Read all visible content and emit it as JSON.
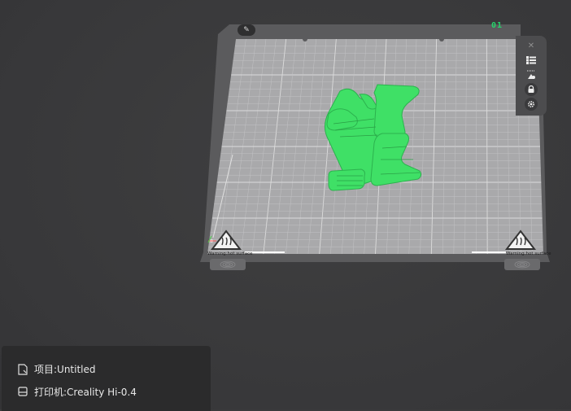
{
  "plate": {
    "tab_label": "01",
    "edit_icon": "pencil-icon",
    "warning_left": "Warning:hot surface",
    "warning_right": "Warning:hot surface"
  },
  "toolbar": {
    "items": [
      {
        "icon": "close-icon"
      },
      {
        "icon": "arrange-icon"
      },
      {
        "icon": "auto-orient-icon"
      },
      {
        "icon": "lock-icon"
      },
      {
        "icon": "gear-icon"
      }
    ]
  },
  "info": {
    "project_icon": "document-icon",
    "project_label": "项目:Untitled",
    "printer_icon": "printer-icon",
    "printer_label": "打印机:Creality Hi-0.4"
  },
  "colors": {
    "model": "#3fe066",
    "plate_grid": "#cfcfcf",
    "plate_bg": "#a9a9ab",
    "tab_active": "#27d36b"
  }
}
